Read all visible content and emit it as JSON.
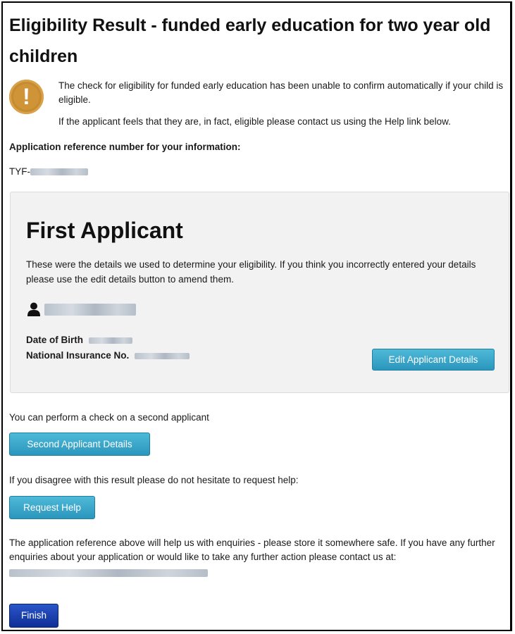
{
  "page": {
    "title": "Eligibility Result - funded early education for two year old children"
  },
  "alert": {
    "icon": "warning-exclamation-icon",
    "message1": "The check for eligibility for funded early education has been unable to confirm automatically if your child is eligible.",
    "message2": "If the applicant feels that they are, in fact, eligible please contact us using the Help link below."
  },
  "reference": {
    "heading": "Application reference number for your information:",
    "prefix": "TYF-"
  },
  "applicant_panel": {
    "title": "First Applicant",
    "description": "These were the details we used to determine your eligibility. If you think you incorrectly entered your details please use the edit details button to amend them.",
    "person_icon": "user-icon",
    "dob_label": "Date of Birth",
    "nin_label": "National Insurance No.",
    "edit_button": "Edit Applicant Details"
  },
  "second": {
    "text": "You can perform a check on a second applicant",
    "button": "Second Applicant Details"
  },
  "help": {
    "text": "If you disagree with this result please do not hesitate to request help:",
    "button": "Request Help"
  },
  "enquiries": {
    "text": "The application reference above will help us with enquiries - please store it somewhere safe. If you have any further enquiries about your application or would like to take any further action please contact us at:"
  },
  "finish": {
    "button": "Finish"
  },
  "colors": {
    "button_teal": "#2b96bd",
    "button_finish": "#0f2f96",
    "warning_icon": "#c58b2e",
    "panel_bg": "#f2f2f2"
  }
}
